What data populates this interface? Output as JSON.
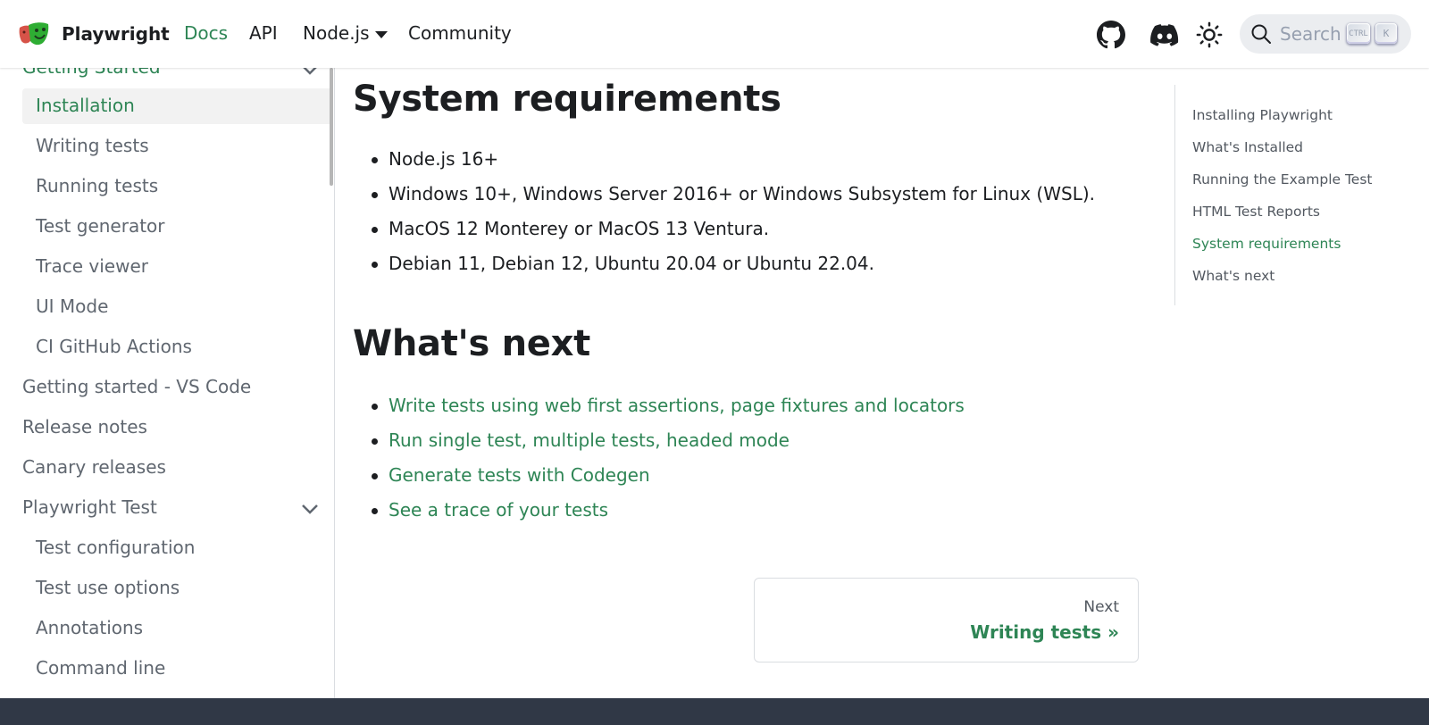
{
  "navbar": {
    "brand": "Playwright",
    "links": [
      {
        "label": "Docs",
        "active": true
      },
      {
        "label": "API",
        "active": false
      },
      {
        "label": "Node.js",
        "dropdown": true
      },
      {
        "label": "Community",
        "active": false
      }
    ],
    "icons": [
      "github-icon",
      "discord-icon",
      "theme-toggle-icon"
    ],
    "search": {
      "placeholder": "Search",
      "shortcut_keys": [
        "CTRL",
        "K"
      ]
    }
  },
  "sidebar": {
    "items": [
      {
        "label": "Getting Started",
        "level": "category",
        "expanded": true,
        "active_parent": true
      },
      {
        "label": "Installation",
        "level": "sub",
        "active": true
      },
      {
        "label": "Writing tests",
        "level": "sub"
      },
      {
        "label": "Running tests",
        "level": "sub"
      },
      {
        "label": "Test generator",
        "level": "sub"
      },
      {
        "label": "Trace viewer",
        "level": "sub"
      },
      {
        "label": "UI Mode",
        "level": "sub"
      },
      {
        "label": "CI GitHub Actions",
        "level": "sub"
      },
      {
        "label": "Getting started - VS Code",
        "level": "category"
      },
      {
        "label": "Release notes",
        "level": "category"
      },
      {
        "label": "Canary releases",
        "level": "category"
      },
      {
        "label": "Playwright Test",
        "level": "category",
        "expanded": true
      },
      {
        "label": "Test configuration",
        "level": "sub"
      },
      {
        "label": "Test use options",
        "level": "sub"
      },
      {
        "label": "Annotations",
        "level": "sub"
      },
      {
        "label": "Command line",
        "level": "sub"
      }
    ]
  },
  "content": {
    "system_requirements": {
      "heading": "System requirements",
      "items": [
        "Node.js 16+",
        "Windows 10+, Windows Server 2016+ or Windows Subsystem for Linux (WSL).",
        "MacOS 12 Monterey or MacOS 13 Ventura.",
        "Debian 11, Debian 12, Ubuntu 20.04 or Ubuntu 22.04."
      ]
    },
    "whats_next": {
      "heading": "What's next",
      "links": [
        "Write tests using web first assertions, page fixtures and locators",
        "Run single test, multiple tests, headed mode",
        "Generate tests with Codegen",
        "See a trace of your tests"
      ]
    },
    "pager": {
      "sublabel": "Next",
      "label": "Writing tests »"
    }
  },
  "toc": {
    "items": [
      {
        "label": "Installing Playwright"
      },
      {
        "label": "What's Installed"
      },
      {
        "label": "Running the Example Test"
      },
      {
        "label": "HTML Test Reports"
      },
      {
        "label": "System requirements",
        "active": true
      },
      {
        "label": "What's next"
      }
    ]
  },
  "colors": {
    "accent": "#2e8555",
    "text": "#1c1e21",
    "muted": "#606770",
    "footer": "#303846"
  }
}
